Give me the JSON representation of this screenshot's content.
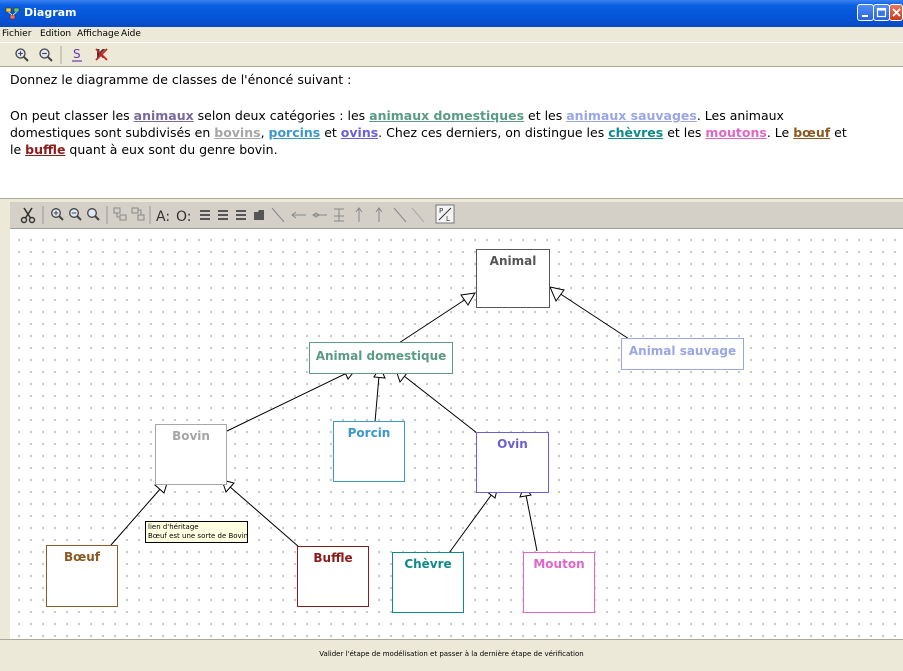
{
  "window": {
    "title": "Diagram"
  },
  "menu": [
    "Fichier",
    "Edition",
    "Affichage",
    "Aide"
  ],
  "toolbar1": {
    "icons": [
      "zoom-in-icon",
      "zoom-out-icon",
      "s-tool-icon",
      "cross-tool-icon"
    ]
  },
  "question": {
    "prompt": "Donnez le diagramme de classes de l'énoncé suivant :",
    "p1": "On peut classer les ",
    "kw_animaux": "animaux",
    "p2": " selon deux catégories : les ",
    "kw_domestiques": "animaux domestiques",
    "p3": " et les ",
    "kw_sauvages": "animaux sauvages",
    "p4": ". Les animaux",
    "p5": "domestiques sont subdivisés en ",
    "kw_bovins": "bovins",
    "p6": ", ",
    "kw_porcins": "porcins",
    "p7": " et ",
    "kw_ovins": "ovins",
    "p8": ". Chez ces derniers, on distingue les ",
    "kw_chevres": "chèvres",
    "p9": " et les ",
    "kw_moutons": "moutons",
    "p10": ". Le ",
    "kw_boeuf": "bœuf",
    "p11": " et",
    "p12": "le ",
    "kw_buffle": "buffle",
    "p13": " quant à eux sont du genre bovin."
  },
  "diagram": {
    "classes": {
      "animal": "Animal",
      "domestique": "Animal domestique",
      "sauvage": "Animal sauvage",
      "bovin": "Bovin",
      "porcin": "Porcin",
      "ovin": "Ovin",
      "boeuf": "Bœuf",
      "buffle": "Buffle",
      "chevre": "Chèvre",
      "mouton": "Mouton"
    },
    "tooltip": {
      "line1": "lien d'héritage",
      "line2": "Bœuf est une sorte de Bovin"
    }
  },
  "colors": {
    "animal": "#555555",
    "domestique": "#5a9a86",
    "sauvage": "#9aa6e6",
    "bovin": "#a6a6a6",
    "porcin": "#3a98cc",
    "ovin": "#6a5fd6",
    "boeuf": "#8a5a22",
    "buffle": "#8e1a1a",
    "chevre": "#0f8a8a",
    "mouton": "#e066c8",
    "animaux": "#7a6a9a"
  },
  "status": {
    "validate_label": "Valider l'étape de modélisation et passer à la dernière étape de vérification"
  }
}
